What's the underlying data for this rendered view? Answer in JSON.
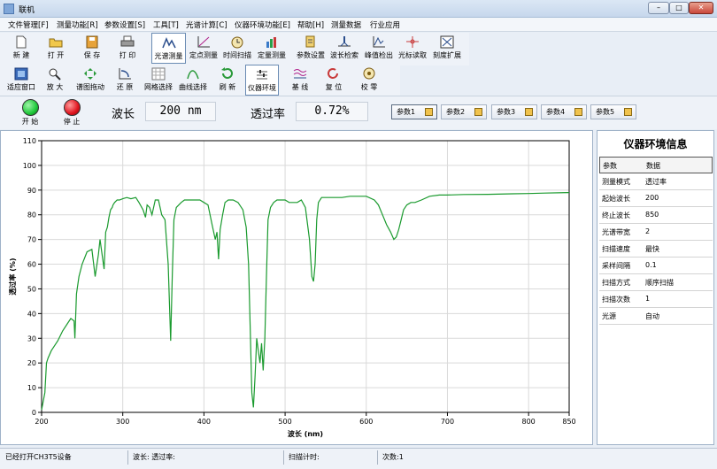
{
  "window": {
    "title": "联机"
  },
  "menu": [
    "文件管理[F]",
    "测量功能[R]",
    "参数设置[S]",
    "工具[T]",
    "光谱计算[C]",
    "仪器环境功能[E]",
    "帮助[H]",
    "测量数据",
    "行业应用"
  ],
  "toolbar1": [
    {
      "label": "新  建",
      "icon": "new-file-icon"
    },
    {
      "label": "打  开",
      "icon": "open-folder-icon"
    },
    {
      "label": "保  存",
      "icon": "save-icon"
    },
    {
      "label": "打  印",
      "icon": "print-icon"
    },
    {
      "label": "光谱测量",
      "icon": "spectrum-scan-icon",
      "selected": true
    },
    {
      "label": "定点测量",
      "icon": "fixed-point-icon"
    },
    {
      "label": "时间扫描",
      "icon": "time-scan-icon"
    },
    {
      "label": "定量测量",
      "icon": "quantitative-icon"
    },
    {
      "label": "参数设置",
      "icon": "parameter-settings-icon"
    },
    {
      "label": "波长检索",
      "icon": "wavelength-search-icon"
    },
    {
      "label": "峰值检出",
      "icon": "peak-detect-icon"
    },
    {
      "label": "光标读取",
      "icon": "cursor-read-icon"
    },
    {
      "label": "刻度扩展",
      "icon": "scale-extend-icon"
    }
  ],
  "toolbar2": [
    {
      "label": "适应窗口",
      "icon": "fit-window-icon"
    },
    {
      "label": "放  大",
      "icon": "zoom-in-icon"
    },
    {
      "label": "谱图拖动",
      "icon": "drag-spectrum-icon"
    },
    {
      "label": "还  原",
      "icon": "restore-icon"
    },
    {
      "label": "网格选择",
      "icon": "grid-select-icon"
    },
    {
      "label": "曲线选择",
      "icon": "curve-select-icon"
    },
    {
      "label": "刷  新",
      "icon": "refresh-icon"
    },
    {
      "label": "仪器环境",
      "icon": "instrument-env-icon",
      "selected": true
    },
    {
      "label": "基  线",
      "icon": "baseline-icon"
    },
    {
      "label": "复  位",
      "icon": "reset-icon"
    },
    {
      "label": "校  零",
      "icon": "zero-calibrate-icon"
    }
  ],
  "controls": {
    "start_label": "开  始",
    "stop_label": "停  止",
    "wavelength_label": "波长",
    "wavelength_value": "200 nm",
    "transmittance_label": "透过率",
    "transmittance_value": "0.72%",
    "param_buttons": [
      "参数1",
      "参数2",
      "参数3",
      "参数4",
      "参数5"
    ]
  },
  "colors": {
    "start": "#1fc83a",
    "stop": "#e0141e",
    "curve": "#1a9a2e",
    "accent": "#4a78b0"
  },
  "info_panel": {
    "title": "仪器环境信息",
    "header": [
      "参数",
      "数据"
    ],
    "rows": [
      [
        "测量模式",
        "透过率"
      ],
      [
        "起始波长",
        "200"
      ],
      [
        "终止波长",
        "850"
      ],
      [
        "光谱带宽",
        "2"
      ],
      [
        "扫描速度",
        "最快"
      ],
      [
        "采样间隔",
        "0.1"
      ],
      [
        "扫描方式",
        "顺序扫描"
      ],
      [
        "扫描次数",
        "1"
      ],
      [
        "光源",
        "自动"
      ]
    ]
  },
  "status": {
    "device": "已经打开CH3T5设备",
    "wl_tr": "波长: 透过率:",
    "timer": "扫描计时:",
    "count": "次数:1"
  },
  "chart_data": {
    "type": "line",
    "xlabel": "波长 (nm)",
    "ylabel": "透过率 (%)",
    "xlim": [
      200,
      850
    ],
    "ylim": [
      0,
      110
    ],
    "xticks": [
      200,
      300,
      400,
      500,
      600,
      700,
      800,
      850
    ],
    "yticks": [
      0,
      10,
      20,
      30,
      40,
      50,
      60,
      70,
      80,
      90,
      100,
      110
    ],
    "grid": true,
    "series": [
      {
        "x": [
          200,
          204,
          206,
          208,
          212,
          216,
          220,
          226,
          232,
          236,
          240,
          241,
          243,
          246,
          250,
          256,
          262,
          266,
          270,
          272,
          274,
          277,
          279,
          281,
          283,
          285,
          287,
          288,
          290,
          293,
          296,
          300,
          305,
          310,
          316,
          320,
          325,
          328,
          330,
          333,
          336,
          340,
          344,
          348,
          352,
          356,
          359,
          361,
          363,
          366,
          369,
          372,
          376,
          380,
          385,
          390,
          395,
          400,
          405,
          410,
          414,
          416,
          418,
          420,
          423,
          426,
          430,
          436,
          442,
          448,
          452,
          455,
          457,
          459,
          461,
          463,
          465,
          467,
          469,
          471,
          473,
          475,
          477,
          479,
          482,
          486,
          490,
          496,
          500,
          505,
          510,
          515,
          520,
          525,
          530,
          533,
          535,
          537,
          539,
          541,
          545,
          550,
          556,
          562,
          570,
          580,
          590,
          600,
          610,
          615,
          620,
          625,
          630,
          634,
          637,
          640,
          643,
          646,
          650,
          655,
          660,
          668,
          678,
          690,
          700,
          720,
          750,
          780,
          800,
          820,
          850
        ],
        "y": [
          1,
          8,
          20,
          22,
          25,
          27,
          29,
          33,
          36,
          38,
          37,
          30,
          48,
          55,
          60,
          65,
          66,
          55,
          64,
          70,
          65,
          58,
          73,
          75,
          79,
          82,
          83,
          84,
          85,
          86,
          86,
          86.5,
          87,
          86.5,
          87,
          85,
          82,
          79,
          84,
          83,
          80,
          86,
          86,
          80,
          78,
          60,
          29,
          55,
          78,
          83,
          84,
          85,
          86,
          86,
          86,
          86,
          86,
          85,
          84,
          76,
          70,
          73,
          62,
          74,
          80,
          85,
          86,
          86,
          85,
          82,
          75,
          60,
          35,
          8,
          2,
          15,
          30,
          25,
          20,
          28,
          17,
          30,
          55,
          78,
          83,
          85,
          86,
          86,
          86,
          85,
          85,
          85,
          86,
          83,
          70,
          55,
          53,
          60,
          78,
          85,
          87,
          87,
          87,
          87,
          87,
          87.5,
          87.5,
          87.5,
          86,
          84,
          80,
          76,
          73,
          70,
          71,
          74,
          78,
          82,
          84,
          85,
          85,
          86,
          87.5,
          88,
          88,
          88.2,
          88.3,
          88.5,
          88.6,
          88.8,
          89
        ]
      }
    ]
  }
}
